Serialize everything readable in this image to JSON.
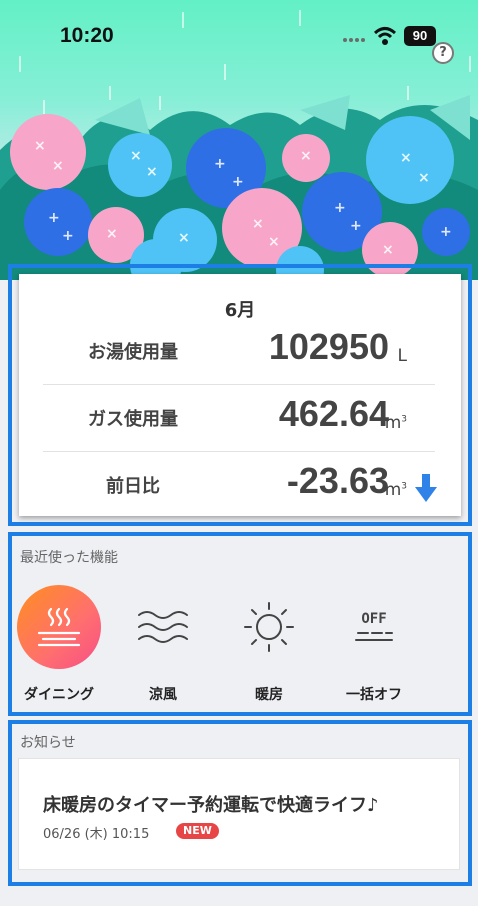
{
  "status_bar": {
    "time": "10:20",
    "battery": "90"
  },
  "help": {
    "label": "?"
  },
  "usage": {
    "month": "6月",
    "rows": [
      {
        "label": "お湯使用量",
        "value": "102950",
        "unit": "L"
      },
      {
        "label": "ガス使用量",
        "value": "462.64",
        "unit": "m"
      },
      {
        "label": "前日比",
        "value": "-23.63",
        "unit": "m"
      }
    ],
    "unit_superscript": "3",
    "trend": "down",
    "trend_icon": "arrow-down-icon"
  },
  "recent": {
    "title": "最近使った機能",
    "items": [
      {
        "label": "ダイニング",
        "icon": "dining-heat-icon",
        "active": true
      },
      {
        "label": "涼風",
        "icon": "cool-wind-icon",
        "active": false
      },
      {
        "label": "暖房",
        "icon": "sun-heating-icon",
        "active": false
      },
      {
        "label": "一括オフ",
        "icon": "off-all-icon",
        "active": false,
        "icon_text": "OFF"
      }
    ]
  },
  "news": {
    "title": "お知らせ",
    "headline": "床暖房のタイマー予約運転で快適ライフ♪",
    "date": "06/26 (木)  10:15",
    "badge": "NEW"
  },
  "colors": {
    "accent": "#1d7fe6",
    "sky_top": "#63f0c6",
    "hydrangea_pink": "#f7a6c9",
    "hydrangea_blue": "#4fc3f5",
    "hydrangea_dark_blue": "#2f6fe6",
    "active_gradient_start": "#ff8f1f",
    "active_gradient_end": "#f74d86",
    "badge_red": "#e84646"
  }
}
